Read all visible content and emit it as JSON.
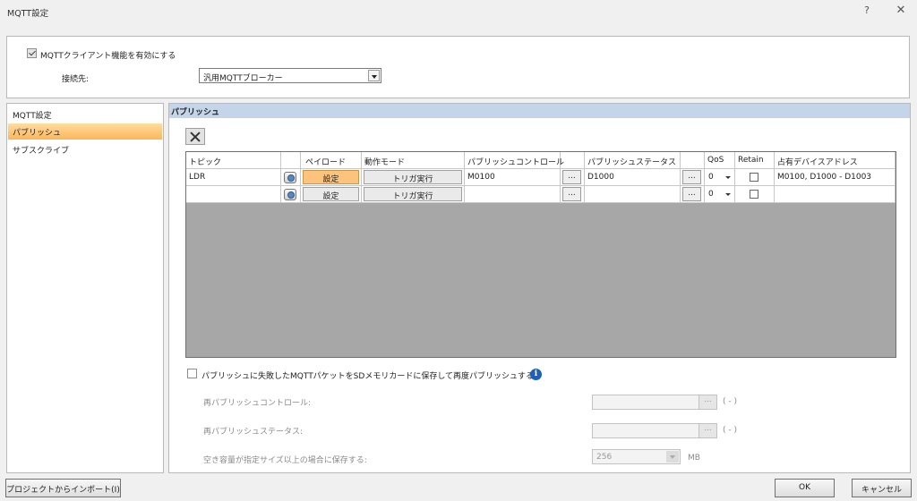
{
  "window": {
    "title": "MQTT設定",
    "help": "?",
    "close": "✕"
  },
  "top": {
    "enable_label": "MQTTクライアント機能を有効にする",
    "enable_checked": true,
    "dest_label": "接続先:",
    "dest_value": "汎用MQTTブローカー"
  },
  "sidebar": {
    "items": [
      {
        "label": "MQTT設定"
      },
      {
        "label": "パブリッシュ"
      },
      {
        "label": "サブスクライブ"
      }
    ],
    "active": "パブリッシュ"
  },
  "publish": {
    "header": "パブリッシュ",
    "columns": [
      "トピック",
      "ペイロード",
      "動作モード",
      "パブリッシュコントロール",
      "パブリッシュステータス",
      "QoS",
      "Retain",
      "占有デバイスアドレス"
    ],
    "rows": [
      {
        "topic": "LDR",
        "payload": "設定",
        "mode": "トリガ実行",
        "control": "M0100",
        "ctl_btn": "...",
        "status": "D1000",
        "st_btn": "...",
        "qos": "0",
        "retain": false,
        "devices": "M0100, D1000 - D1003"
      },
      {
        "topic": "",
        "payload": "設定",
        "mode": "トリガ実行",
        "control": "",
        "ctl_btn": "...",
        "status": "",
        "st_btn": "...",
        "qos": "0",
        "retain": false,
        "devices": ""
      }
    ],
    "sd_label": "パブリッシュに失敗したMQTTパケットをSDメモリカードに保存して再度パブリッシュする",
    "sd_checked": false,
    "info_icon": "i",
    "repub_control_label": "再パブリッシュコントロール:",
    "repub_control_unit": "( - )",
    "repub_status_label": "再パブリッシュステータス:",
    "repub_status_unit": "( - )",
    "space_label": "空き容量が指定サイズ以上の場合に保存する:",
    "space_value": "256",
    "space_unit": "MB",
    "browse": "..."
  },
  "footer": {
    "import_label": "プロジェクトからインポート(I)",
    "ok_label": "OK",
    "cancel_label": "キャンセル"
  }
}
